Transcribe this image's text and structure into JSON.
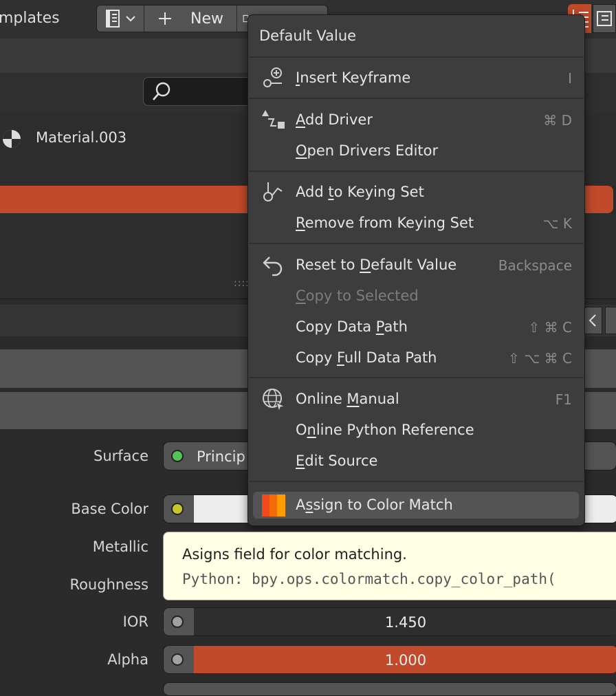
{
  "header": {
    "templates_label": "mplates",
    "new_label": "New",
    "icons": [
      "template-icon",
      "plus-icon",
      "browse-icon",
      "list-icon"
    ]
  },
  "material": {
    "name": "Material.003"
  },
  "context_menu": {
    "title": "Default Value",
    "sections": [
      [
        {
          "label": "Insert Keyframe",
          "shortcut": "I",
          "icon": "keyframe-icon",
          "enabled": true
        }
      ],
      [
        {
          "label": "Add Driver",
          "shortcut": "⌘ D",
          "icon": "driver-icon",
          "enabled": true
        },
        {
          "label": "Open Drivers Editor",
          "shortcut": "",
          "enabled": true
        }
      ],
      [
        {
          "label": "Add to Keying Set",
          "shortcut": "",
          "icon": "keying-set-icon",
          "enabled": true
        },
        {
          "label": "Remove from Keying Set",
          "shortcut": "⌥ K",
          "enabled": true
        }
      ],
      [
        {
          "label": "Reset to Default Value",
          "shortcut": "Backspace",
          "icon": "undo-icon",
          "enabled": true
        },
        {
          "label": "Copy to Selected",
          "shortcut": "",
          "enabled": false
        },
        {
          "label": "Copy Data Path",
          "shortcut": "⇧ ⌘ C",
          "enabled": true
        },
        {
          "label": "Copy Full Data Path",
          "shortcut": "⇧ ⌥ ⌘ C",
          "enabled": true
        }
      ],
      [
        {
          "label": "Online Manual",
          "shortcut": "F1",
          "icon": "globe-icon",
          "enabled": true
        },
        {
          "label": "Online Python Reference",
          "shortcut": "",
          "enabled": true
        },
        {
          "label": "Edit Source",
          "shortcut": "",
          "enabled": true
        }
      ],
      [
        {
          "label": "Assign to Color Match",
          "shortcut": "",
          "icon": "color-match-icon",
          "enabled": true,
          "highlighted": true
        }
      ]
    ]
  },
  "tooltip": {
    "description": "Asigns field for color matching.",
    "python": "Python: bpy.ops.colormatch.copy_color_path("
  },
  "properties": {
    "surface": {
      "label": "Surface",
      "value": "Princip"
    },
    "base_color": {
      "label": "Base Color"
    },
    "metallic": {
      "label": "Metallic"
    },
    "roughness": {
      "label": "Roughness"
    },
    "ior": {
      "label": "IOR",
      "value": "1.450"
    },
    "alpha": {
      "label": "Alpha",
      "value": "1.000",
      "fraction": 1.0
    }
  },
  "colors": {
    "accent": "#c14a2b",
    "surface_socket": "#56c156",
    "base_color_socket": "#c7c729",
    "float_socket": "#a1a1a1",
    "tooltip_bg": "#ffffe6",
    "menu_bg": "#3d3d3d"
  }
}
